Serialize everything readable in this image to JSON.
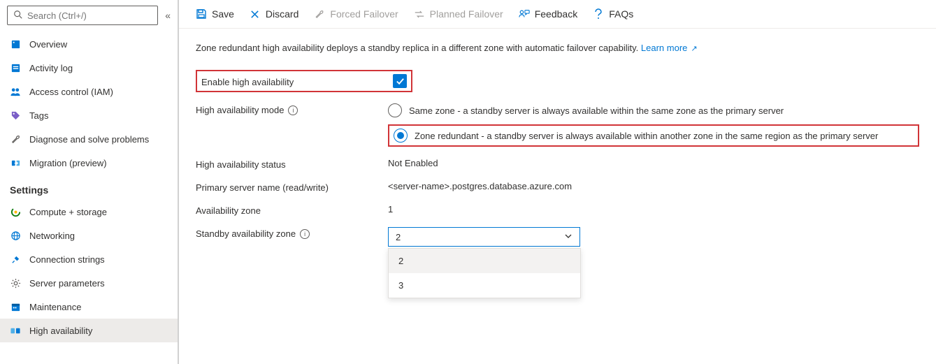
{
  "search": {
    "placeholder": "Search (Ctrl+/)"
  },
  "sidebar": {
    "items": [
      {
        "label": "Overview"
      },
      {
        "label": "Activity log"
      },
      {
        "label": "Access control (IAM)"
      },
      {
        "label": "Tags"
      },
      {
        "label": "Diagnose and solve problems"
      },
      {
        "label": "Migration (preview)"
      }
    ],
    "settings_heading": "Settings",
    "settings": [
      {
        "label": "Compute + storage"
      },
      {
        "label": "Networking"
      },
      {
        "label": "Connection strings"
      },
      {
        "label": "Server parameters"
      },
      {
        "label": "Maintenance"
      },
      {
        "label": "High availability"
      }
    ]
  },
  "toolbar": {
    "save": "Save",
    "discard": "Discard",
    "forced_failover": "Forced Failover",
    "planned_failover": "Planned Failover",
    "feedback": "Feedback",
    "faqs": "FAQs"
  },
  "content": {
    "description": "Zone redundant high availability deploys a standby replica in a different zone with automatic failover capability.",
    "learn_more": "Learn more",
    "enable_ha_label": "Enable high availability",
    "ha_mode_label": "High availability mode",
    "ha_mode_options": {
      "same_zone": "Same zone - a standby server is always available within the same zone as the primary server",
      "zone_redundant": "Zone redundant - a standby server is always available within another zone in the same region as the primary server"
    },
    "ha_status_label": "High availability status",
    "ha_status_value": "Not Enabled",
    "primary_server_label": "Primary server name (read/write)",
    "primary_server_value": "<server-name>.postgres.database.azure.com",
    "availability_zone_label": "Availability zone",
    "availability_zone_value": "1",
    "standby_zone_label": "Standby availability zone",
    "standby_zone_value": "2",
    "standby_zone_options": [
      "2",
      "3"
    ]
  }
}
